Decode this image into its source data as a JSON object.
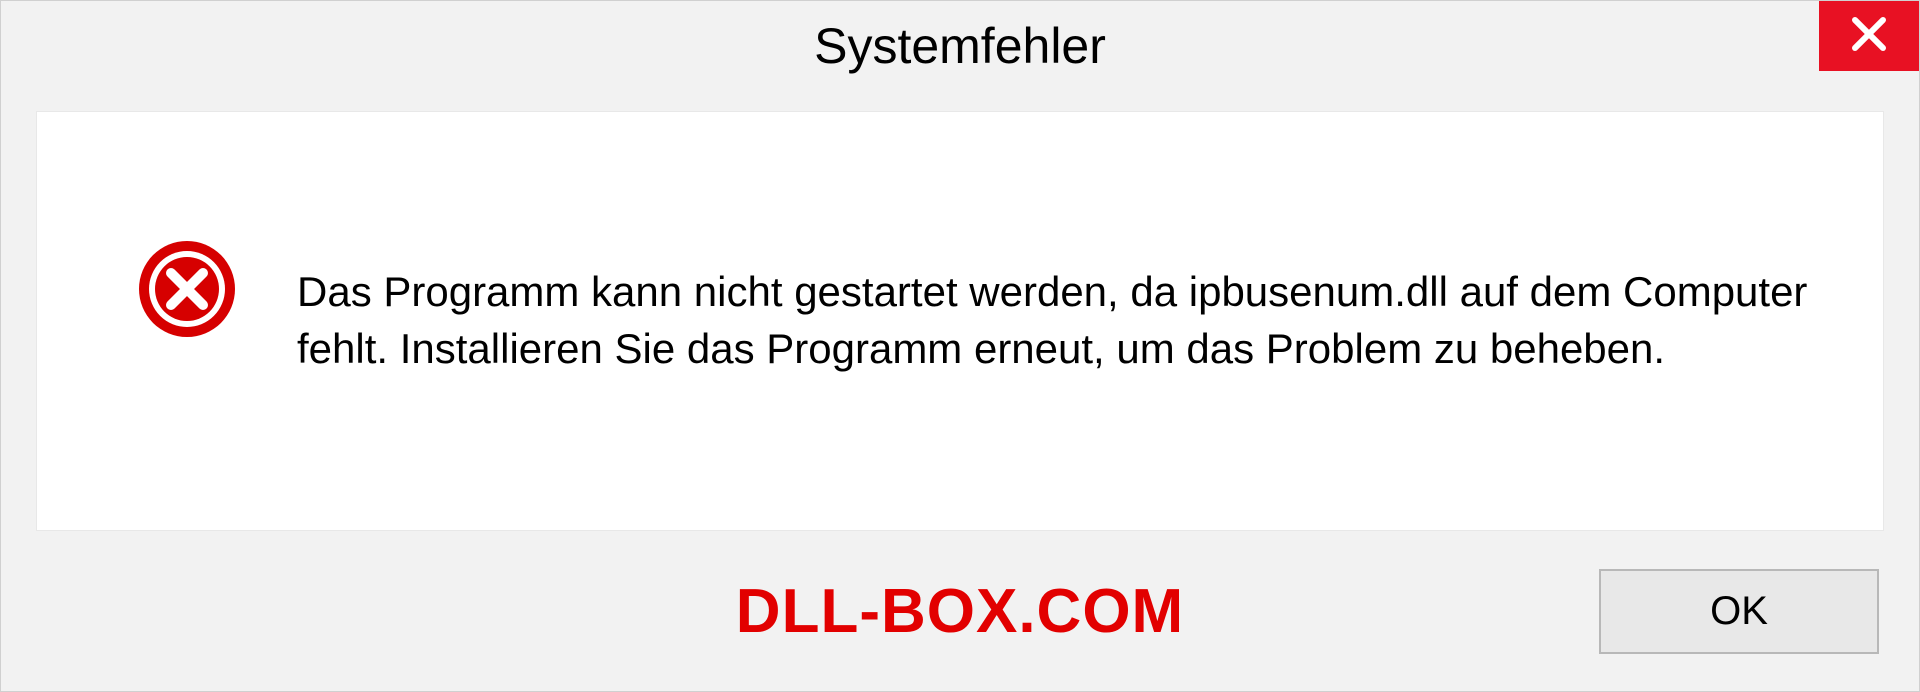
{
  "dialog": {
    "title": "Systemfehler",
    "message": "Das Programm kann nicht gestartet werden, da ipbusenum.dll auf dem Computer fehlt. Installieren Sie das Programm erneut, um das Problem zu beheben.",
    "ok_label": "OK"
  },
  "watermark": "DLL-BOX.COM"
}
